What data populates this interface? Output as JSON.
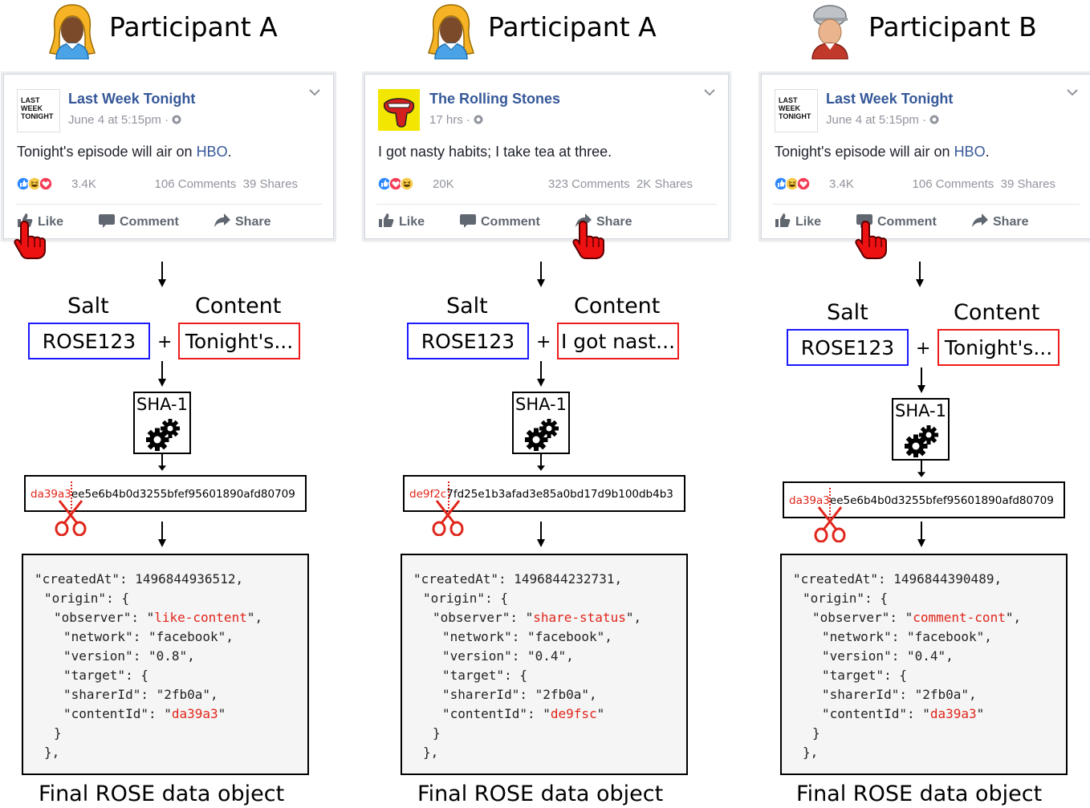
{
  "columns": [
    {
      "participant": "Participant A",
      "avatar": "female",
      "post": {
        "page_name": "Last Week Tonight",
        "logo": "last-week-tonight-logo",
        "logo_text": "LAST WEEK TONIGHT",
        "time": "June 4 at 5:15pm · ",
        "text": "Tonight's episode will air on ",
        "link": "HBO",
        "text_end": ".",
        "reactions": [
          "like",
          "haha",
          "love"
        ],
        "reaction_count": "3.4K",
        "comments": "106 Comments",
        "shares": "39 Shares",
        "actions": {
          "like": "Like",
          "comment": "Comment",
          "share": "Share"
        },
        "clicked": "like"
      },
      "salt_label": "Salt",
      "content_label": "Content",
      "salt": "ROSE123",
      "plus": "+",
      "content": "Tonight's...",
      "hash_function": "SHA-1",
      "hash_prefix": "da39a3",
      "hash_rest": "ee5e6b4b0d3255bfef95601890afd80709",
      "code": {
        "l1": "\"createdAt\": 1496844936512,",
        "l2": "\"origin\": {",
        "l3a": "\"observer\": \"",
        "observer": "like-content",
        "l3b": "\",",
        "l4": "\"network\": \"facebook\",",
        "l5": "\"version\": \"0.8\",",
        "l6": "\"target\": {",
        "l7": "\"sharerId\": \"2fb0a\",",
        "l8a": "\"contentId\": \"",
        "content_id": "da39a3",
        "l8b": "\"",
        "l9": "}",
        "l10": "},"
      },
      "caption": "Final ROSE data object"
    },
    {
      "participant": "Participant A",
      "avatar": "female",
      "post": {
        "page_name": "The Rolling Stones",
        "logo": "rolling-stones-tongue-logo",
        "logo_text": "",
        "time": "17 hrs · ",
        "text": "I got nasty habits; I take tea at three.",
        "link": "",
        "text_end": "",
        "reactions": [
          "like",
          "love",
          "haha"
        ],
        "reaction_count": "20K",
        "comments": "323 Comments",
        "shares": "2K Shares",
        "actions": {
          "like": "Like",
          "comment": "Comment",
          "share": "Share"
        },
        "clicked": "share"
      },
      "salt_label": "Salt",
      "content_label": "Content",
      "salt": "ROSE123",
      "plus": "+",
      "content": "I got nast...",
      "hash_function": "SHA-1",
      "hash_prefix": "de9f2c",
      "hash_rest": "7fd25e1b3afad3e85a0bd17d9b100db4b3",
      "code": {
        "l1": "\"createdAt\": 1496844232731,",
        "l2": "\"origin\": {",
        "l3a": "\"observer\": \"",
        "observer": "share-status",
        "l3b": "\",",
        "l4": "\"network\": \"facebook\",",
        "l5": "\"version\": \"0.4\",",
        "l6": "\"target\": {",
        "l7": "\"sharerId\": \"2fb0a\",",
        "l8a": "\"contentId\": \"",
        "content_id": "de9fsc",
        "l8b": "\"",
        "l9": "}",
        "l10": "},"
      },
      "caption": "Final ROSE data object"
    },
    {
      "participant": "Participant B",
      "avatar": "male-cap",
      "post": {
        "page_name": "Last Week Tonight",
        "logo": "last-week-tonight-logo",
        "logo_text": "LAST WEEK TONIGHT",
        "time": "June 4 at 5:15pm · ",
        "text": "Tonight's episode will air on ",
        "link": "HBO",
        "text_end": ".",
        "reactions": [
          "like",
          "haha",
          "love"
        ],
        "reaction_count": "3.4K",
        "comments": "106 Comments",
        "shares": "39 Shares",
        "actions": {
          "like": "Like",
          "comment": "Comment",
          "share": "Share"
        },
        "clicked": "comment"
      },
      "salt_label": "Salt",
      "content_label": "Content",
      "salt": "ROSE123",
      "plus": "+",
      "content": "Tonight's...",
      "hash_function": "SHA-1",
      "hash_prefix": "da39a3",
      "hash_rest": "ee5e6b4b0d3255bfef95601890afd80709",
      "code": {
        "l1": "\"createdAt\": 1496844390489,",
        "l2": "\"origin\": {",
        "l3a": "\"observer\": \"",
        "observer": "comment-cont",
        "l3b": "\",",
        "l4": "\"network\": \"facebook\",",
        "l5": "\"version\": \"0.4\",",
        "l6": "\"target\": {",
        "l7": "\"sharerId\": \"2fb0a\",",
        "l8a": "\"contentId\": \"",
        "content_id": "da39a3",
        "l8b": "\"",
        "l9": "}",
        "l10": "},"
      },
      "caption": "Final ROSE data object"
    }
  ],
  "colors": {
    "salt_border": "#1a1aff",
    "content_border": "#ee1c1c",
    "highlight_red": "#e0261b",
    "facebook_link": "#365899"
  }
}
